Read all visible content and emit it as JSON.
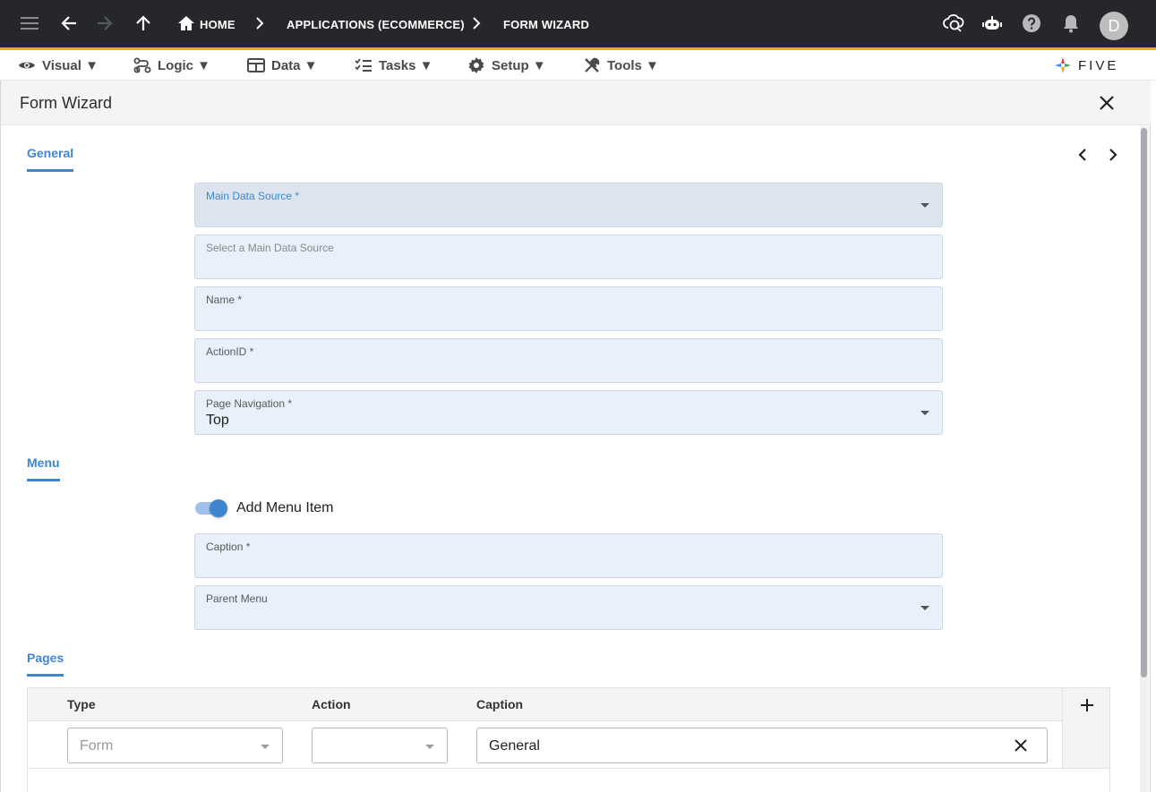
{
  "topbar": {
    "breadcrumbs": [
      "HOME",
      "APPLICATIONS (ECOMMERCE)",
      "FORM WIZARD"
    ],
    "avatar_initial": "D"
  },
  "menubar": {
    "items": [
      "Visual ▼",
      "Logic ▼",
      "Data ▼",
      "Tasks ▼",
      "Setup ▼",
      "Tools ▼"
    ],
    "logo_text": "FIVE"
  },
  "panel": {
    "title": "Form Wizard"
  },
  "sections": {
    "general": "General",
    "menu": "Menu",
    "pages": "Pages"
  },
  "general_fields": {
    "main_data_source_label": "Main Data Source *",
    "main_data_source_value": "",
    "select_hint_label": "Select a Main Data Source",
    "name_label": "Name *",
    "name_value": "",
    "actionid_label": "ActionID *",
    "actionid_value": "",
    "page_navigation_label": "Page Navigation *",
    "page_navigation_value": "Top"
  },
  "menu_fields": {
    "add_menu_item_label": "Add Menu Item",
    "add_menu_item_on": true,
    "caption_label": "Caption *",
    "caption_value": "",
    "parent_menu_label": "Parent Menu",
    "parent_menu_value": ""
  },
  "pages_table": {
    "columns": [
      "Type",
      "Action",
      "Caption"
    ],
    "rows": [
      {
        "type_placeholder": "Form",
        "action": "",
        "caption": "General"
      }
    ]
  },
  "colors": {
    "topbar_bg": "#25272a",
    "accent_bar": "#f0a819",
    "primary": "#3f86d1",
    "field_bg": "#e8f0fb"
  }
}
